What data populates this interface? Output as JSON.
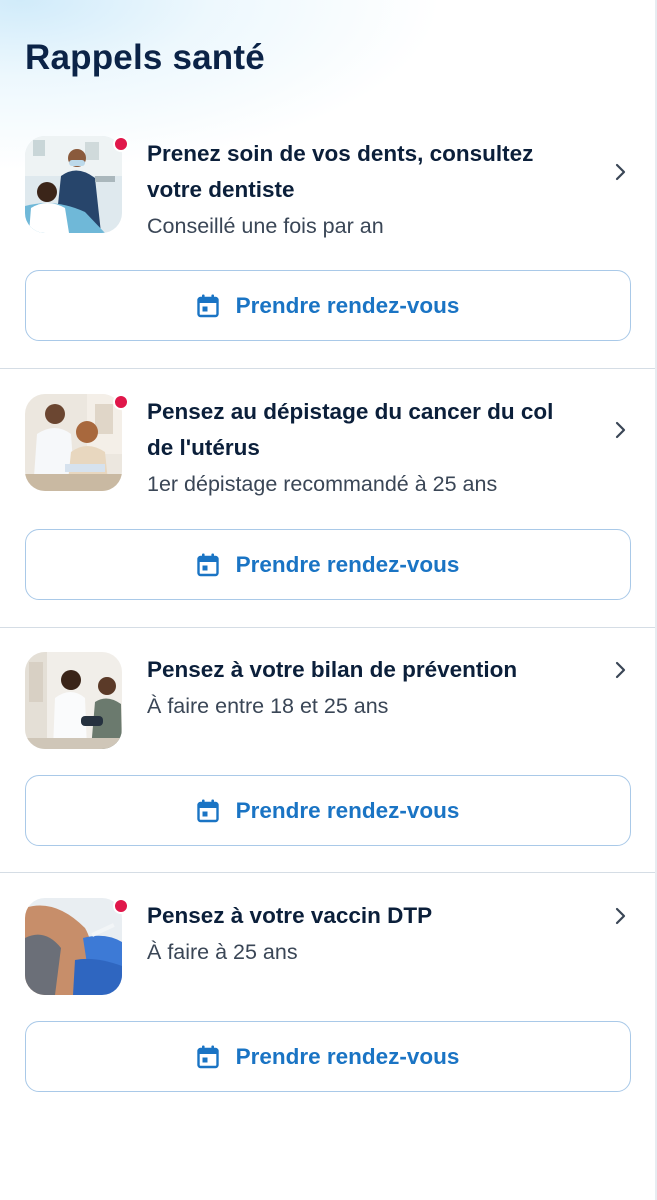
{
  "header": {
    "title": "Rappels santé"
  },
  "colors": {
    "title": "#0b2347",
    "accent": "#1a74c4",
    "notification_dot": "#e0174a",
    "button_border": "#a9c9e8"
  },
  "reminders": [
    {
      "title": "Prenez soin de vos dents, consultez votre dentiste",
      "subtitle": "Conseillé une fois par an",
      "image": "dentist-photo",
      "has_notification": true,
      "button_label": "Prendre rendez-vous"
    },
    {
      "title": "Pensez au dépistage du cancer du col de l'utérus",
      "subtitle": "1er dépistage recommandé à 25 ans",
      "image": "doctor-consultation-photo",
      "has_notification": true,
      "button_label": "Prendre rendez-vous"
    },
    {
      "title": "Pensez à votre bilan de prévention",
      "subtitle": "À faire entre 18 et 25 ans",
      "image": "blood-pressure-photo",
      "has_notification": false,
      "button_label": "Prendre rendez-vous"
    },
    {
      "title": "Pensez à votre vaccin DTP",
      "subtitle": "À faire à 25 ans",
      "image": "vaccination-photo",
      "has_notification": true,
      "button_label": "Prendre rendez-vous"
    }
  ],
  "icons": {
    "chevron": "chevron-right-icon",
    "calendar": "calendar-icon"
  }
}
